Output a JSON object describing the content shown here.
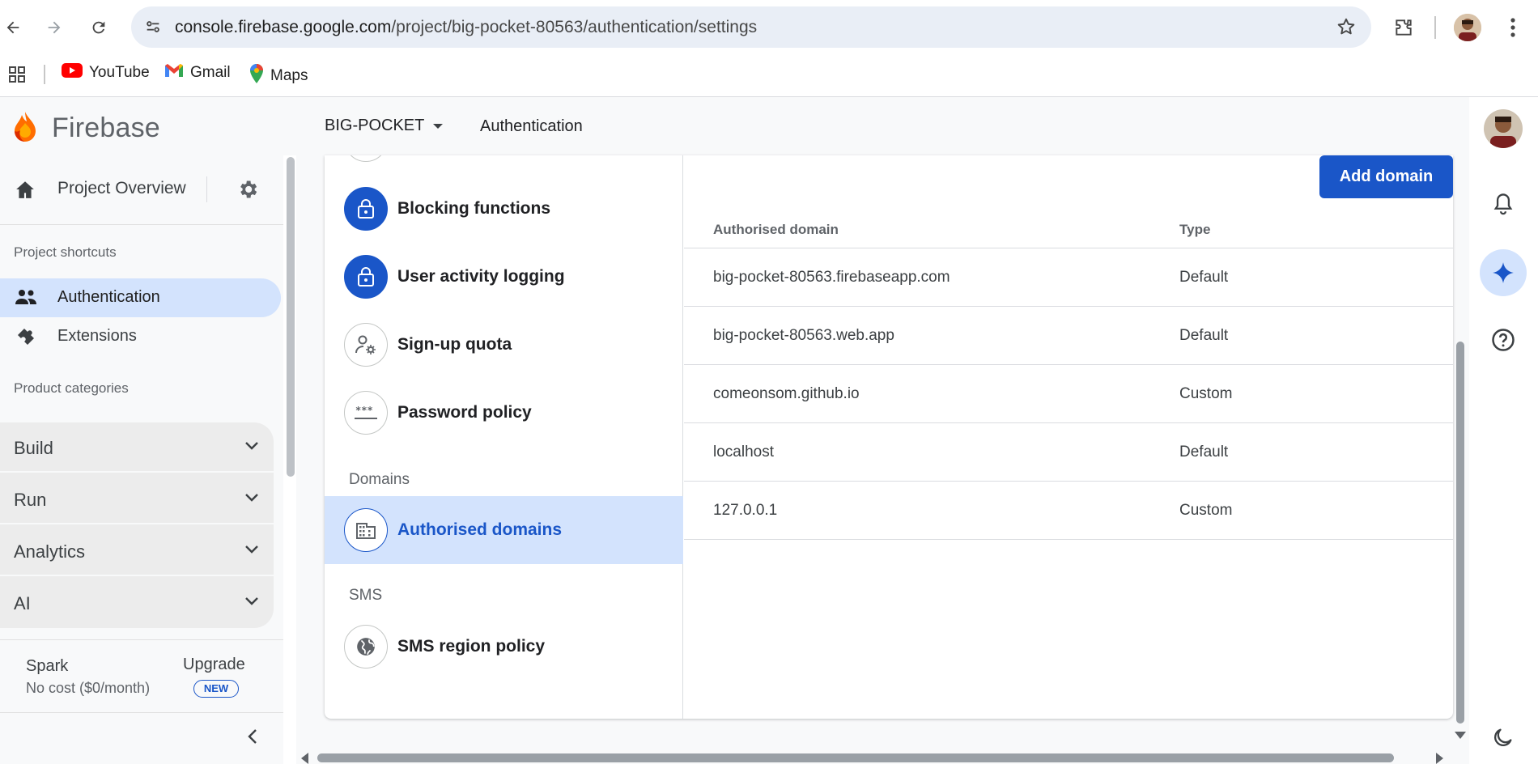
{
  "browser": {
    "url_host": "console.firebase.google.com",
    "url_path": "/project/big-pocket-80563/authentication/settings",
    "bookmarks": [
      {
        "label": "YouTube",
        "icon": "youtube-icon"
      },
      {
        "label": "Gmail",
        "icon": "gmail-icon"
      },
      {
        "label": "Maps",
        "icon": "maps-icon"
      }
    ]
  },
  "header": {
    "brand": "Firebase",
    "project": "BIG-POCKET",
    "section": "Authentication"
  },
  "sidebar": {
    "overview": "Project Overview",
    "shortcuts_caption": "Project shortcuts",
    "shortcuts": [
      {
        "label": "Authentication",
        "icon": "people-icon",
        "active": true
      },
      {
        "label": "Extensions",
        "icon": "extensions-icon",
        "active": false
      }
    ],
    "categories_caption": "Product categories",
    "categories": [
      "Build",
      "Run",
      "Analytics",
      "AI"
    ],
    "plan": {
      "name": "Spark",
      "cost": "No cost ($0/month)",
      "upgrade": "Upgrade",
      "badge": "NEW"
    }
  },
  "settings_nav": {
    "items": [
      {
        "label": "Blocking functions",
        "icon": "lock-icon"
      },
      {
        "label": "User activity logging",
        "icon": "lock-icon"
      },
      {
        "label": "Sign-up quota",
        "icon": "user-settings-icon"
      },
      {
        "label": "Password policy",
        "icon": "password-icon"
      }
    ],
    "domains_caption": "Domains",
    "domains_item": "Authorised domains",
    "sms_caption": "SMS",
    "sms_item": "SMS region policy"
  },
  "domains": {
    "add_button": "Add domain",
    "columns": [
      "Authorised domain",
      "Type"
    ],
    "rows": [
      {
        "domain": "big-pocket-80563.firebaseapp.com",
        "type": "Default"
      },
      {
        "domain": "big-pocket-80563.web.app",
        "type": "Default"
      },
      {
        "domain": "comeonsom.github.io",
        "type": "Custom"
      },
      {
        "domain": "localhost",
        "type": "Default"
      },
      {
        "domain": "127.0.0.1",
        "type": "Custom"
      }
    ]
  },
  "colors": {
    "accent": "#1a56c8",
    "active_bg": "#d3e3fd"
  }
}
